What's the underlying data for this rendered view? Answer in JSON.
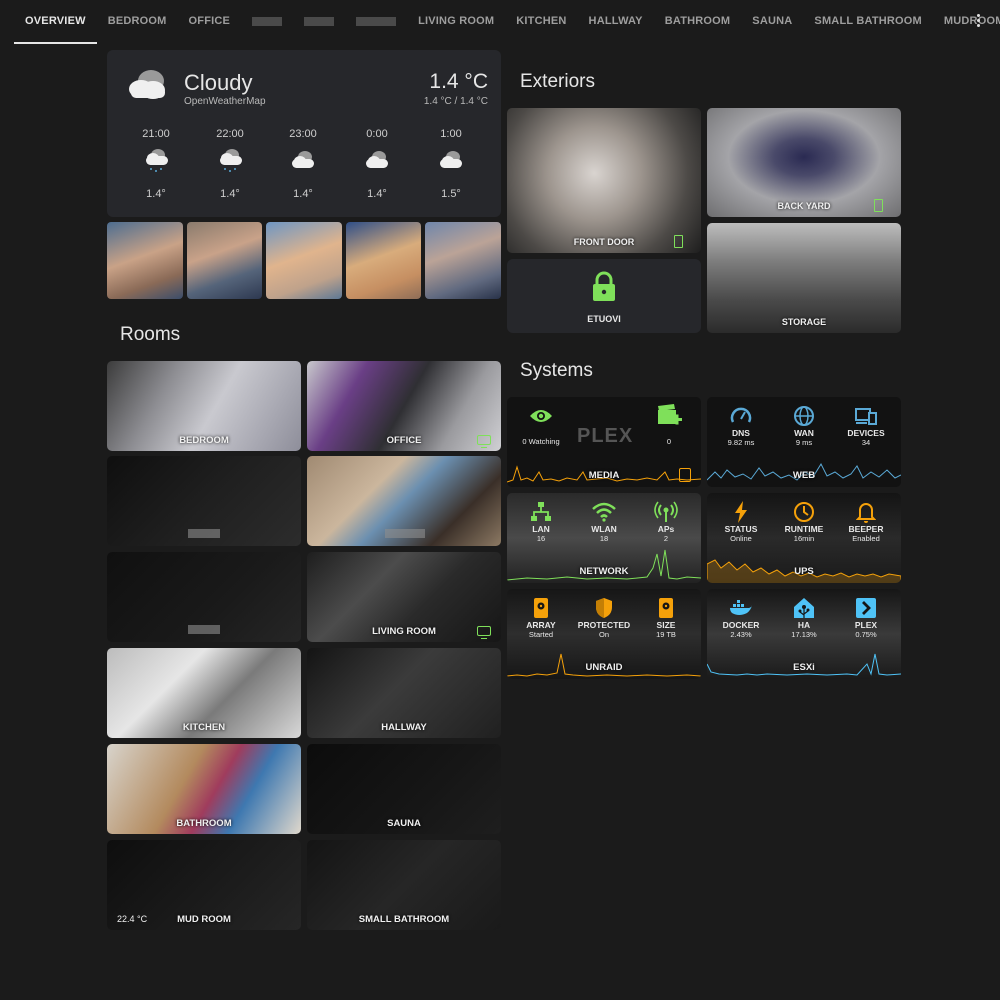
{
  "tabs": [
    "OVERVIEW",
    "BEDROOM",
    "OFFICE",
    "",
    "",
    "",
    "LIVING ROOM",
    "KITCHEN",
    "HALLWAY",
    "BATHROOM",
    "SAUNA",
    "SMALL BATHROOM",
    "MUDROOM"
  ],
  "weather": {
    "condition": "Cloudy",
    "source": "OpenWeatherMap",
    "temperature": "1.4 °C",
    "range": "1.4 °C / 1.4 °C",
    "forecast": [
      {
        "time": "21:00",
        "icon": "rainy-icon",
        "temp": "1.4°"
      },
      {
        "time": "22:00",
        "icon": "rainy-icon",
        "temp": "1.4°"
      },
      {
        "time": "23:00",
        "icon": "cloudy-icon",
        "temp": "1.4°"
      },
      {
        "time": "0:00",
        "icon": "cloudy-icon",
        "temp": "1.4°"
      },
      {
        "time": "1:00",
        "icon": "cloudy-icon",
        "temp": "1.5°"
      }
    ]
  },
  "sections": {
    "exteriors": "Exteriors",
    "rooms": "Rooms",
    "systems": "Systems"
  },
  "exteriors": {
    "front_door": "FRONT DOOR",
    "back_yard": "BACK YARD",
    "lock": "ETUOVI",
    "storage": "STORAGE"
  },
  "rooms": {
    "bedroom": "BEDROOM",
    "office": "OFFICE",
    "living_room": "LIVING ROOM",
    "kitchen": "KITCHEN",
    "hallway": "HALLWAY",
    "bathroom": "BATHROOM",
    "sauna": "SAUNA",
    "mudroom": "MUD ROOM",
    "small_bathroom": "SMALL BATHROOM",
    "mudroom_temp": "22.4 °C"
  },
  "systems": {
    "media": {
      "label": "MEDIA",
      "watching": "0 Watching",
      "count": "0",
      "logo": "PLEX"
    },
    "web": {
      "label": "WEB",
      "dns_name": "DNS",
      "dns_val": "9.82 ms",
      "wan_name": "WAN",
      "wan_val": "9 ms",
      "dev_name": "DEVICES",
      "dev_val": "34"
    },
    "network": {
      "label": "NETWORK",
      "lan_name": "LAN",
      "lan_val": "16",
      "wlan_name": "WLAN",
      "wlan_val": "18",
      "aps_name": "APs",
      "aps_val": "2"
    },
    "ups": {
      "label": "UPS",
      "status_name": "STATUS",
      "status_val": "Online",
      "runtime_name": "RUNTIME",
      "runtime_val": "16min",
      "beeper_name": "BEEPER",
      "beeper_val": "Enabled"
    },
    "unraid": {
      "label": "UNRAID",
      "array_name": "ARRAY",
      "array_val": "Started",
      "prot_name": "PROTECTED",
      "prot_val": "On",
      "size_name": "SIZE",
      "size_val": "19 TB"
    },
    "esxi": {
      "label": "ESXi",
      "docker_name": "DOCKER",
      "docker_val": "2.43%",
      "ha_name": "HA",
      "ha_val": "17.13%",
      "plex_name": "PLEX",
      "plex_val": "0.75%"
    }
  },
  "colors": {
    "green": "#7fe05a",
    "orange": "#f5a10a",
    "blue": "#5aa9d6",
    "lightblue": "#4fc3f7"
  }
}
